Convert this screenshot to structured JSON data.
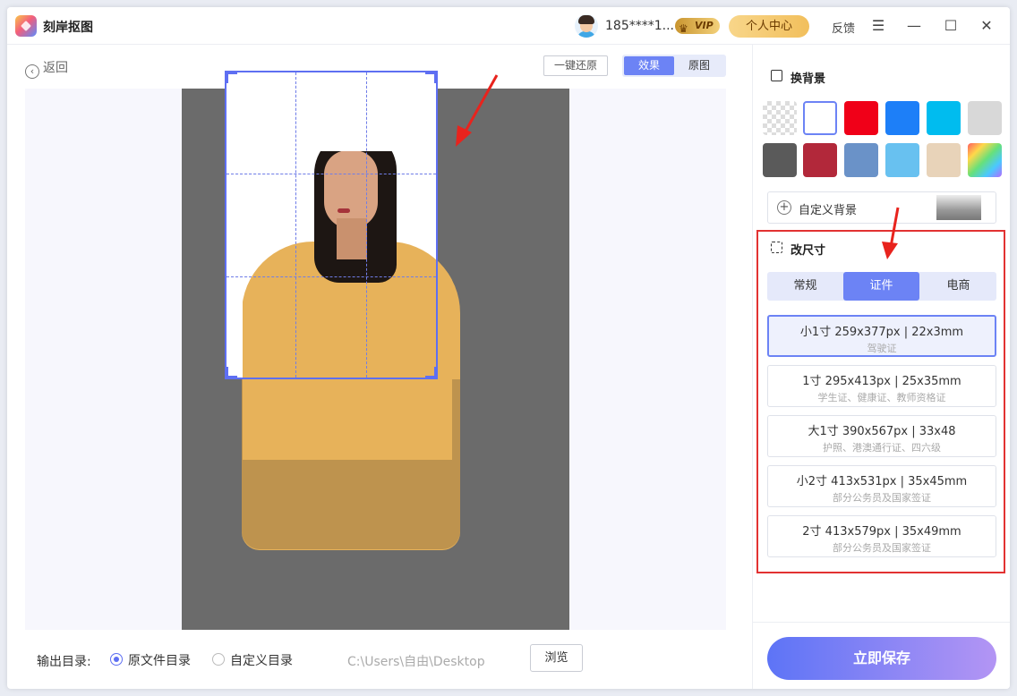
{
  "app": {
    "title": "刻岸抠图"
  },
  "header": {
    "user_name": "185****1...",
    "vip_label": "VIP",
    "center_button": "个人中心",
    "feedback": "反馈",
    "menu_icon": "☰",
    "minimize_icon": "—",
    "maximize_icon": "☐",
    "close_icon": "✕"
  },
  "toolbar": {
    "back_label": "返回",
    "reset_label": "一键还原",
    "view_effect": "效果",
    "view_original": "原图"
  },
  "output": {
    "label": "输出目录:",
    "option_original": "原文件目录",
    "option_custom": "自定义目录",
    "path": "C:\\Users\\自由\\Desktop",
    "browse_label": "浏览"
  },
  "background_section": {
    "title": "换背景",
    "swatches": [
      "transparent",
      "#ffffff",
      "#f00018",
      "#1d7ff8",
      "#00bcef",
      "#d8d8d8",
      "#5a5a5a",
      "#b2283a",
      "#6a92c8",
      "#68c1f0",
      "#e8d3b9",
      "rainbow"
    ],
    "custom_label": "自定义背景"
  },
  "resize_section": {
    "title": "改尺寸",
    "tabs": [
      {
        "label": "常规"
      },
      {
        "label": "证件"
      },
      {
        "label": "电商"
      }
    ],
    "active_tab": "证件",
    "sizes": [
      {
        "main": "小1寸 259x377px | 22x3mm",
        "sub": "驾驶证"
      },
      {
        "main": "1寸 295x413px | 25x35mm",
        "sub": "学生证、健康证、教师资格证"
      },
      {
        "main": "大1寸 390x567px | 33x48",
        "sub": "护照、港澳通行证、四六级"
      },
      {
        "main": "小2寸 413x531px | 35x45mm",
        "sub": "部分公务员及国家签证"
      },
      {
        "main": "2寸 413x579px | 35x49mm",
        "sub": "部分公务员及国家签证"
      }
    ],
    "selected_index": 0
  },
  "save_button": "立即保存",
  "colors": {
    "accent": "#6c83f5",
    "highlight_red": "#e23232"
  }
}
